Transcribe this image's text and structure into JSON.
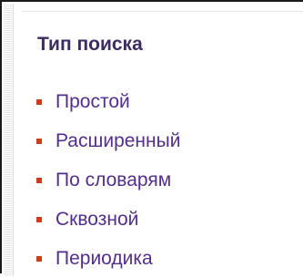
{
  "search_panel": {
    "title": "Тип поиска",
    "bullet_color": "#cc3d1c",
    "link_color": "#532e8c",
    "title_color": "#3c2c62",
    "items": [
      {
        "label": "Простой"
      },
      {
        "label": "Расширенный"
      },
      {
        "label": "По словарям"
      },
      {
        "label": "Сквозной"
      },
      {
        "label": "Периодика"
      }
    ]
  }
}
